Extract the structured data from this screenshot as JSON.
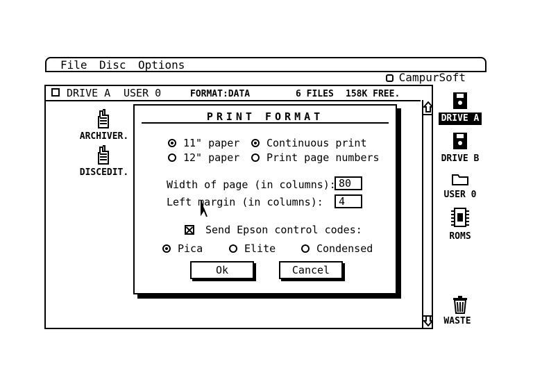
{
  "menubar": {
    "file": "File",
    "disc": "Disc",
    "options": "Options",
    "brand": "CampurSoft",
    "brand_icon": "copyright-icon"
  },
  "window": {
    "drive": "DRIVE A",
    "user": "USER 0",
    "format": "FORMAT:DATA",
    "files": "6 FILES",
    "free": "158K FREE.",
    "icons": [
      {
        "label": "ARCHIVER.",
        "icon": "hand-program-icon"
      },
      {
        "label": "DISCEDIT.",
        "icon": "hand-program-icon"
      }
    ]
  },
  "dialog": {
    "title": "PRINT FORMAT",
    "paper11": "11\" paper",
    "paper12": "12\" paper",
    "continuous": "Continuous print",
    "page_numbers": "Print page numbers",
    "width_label": "Width of page (in columns):",
    "width_value": "80",
    "margin_label": "Left margin (in columns):",
    "margin_value": "4",
    "epson": "Send Epson control codes:",
    "pica": "Pica",
    "elite": "Elite",
    "condensed": "Condensed",
    "ok": "Ok",
    "cancel": "Cancel"
  },
  "desktop": {
    "drive_a": "DRIVE A",
    "drive_b": "DRIVE B",
    "user0": "USER 0",
    "roms": "ROMS",
    "waste": "WASTE"
  }
}
